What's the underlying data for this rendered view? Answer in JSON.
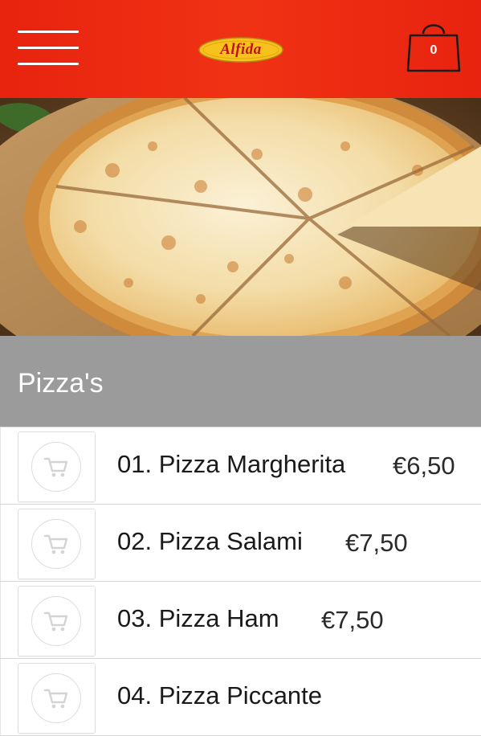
{
  "header": {
    "logo_text": "Alfida",
    "cart_count": "0",
    "background_color": "#ee2c12",
    "menu_icon": "hamburger-menu-icon",
    "cart_icon": "shopping-bag-icon"
  },
  "hero": {
    "image": "pizza-margherita-photo"
  },
  "section": {
    "title": "Pizza's"
  },
  "menu_items": [
    {
      "name": "01. Pizza Margherita",
      "price": "€6,50"
    },
    {
      "name": "02. Pizza Salami",
      "price": "€7,50"
    },
    {
      "name": "03. Pizza Ham",
      "price": "€7,50"
    },
    {
      "name": "04. Pizza Piccante",
      "price": ""
    }
  ],
  "add_to_cart_icon": "shopping-cart-icon"
}
